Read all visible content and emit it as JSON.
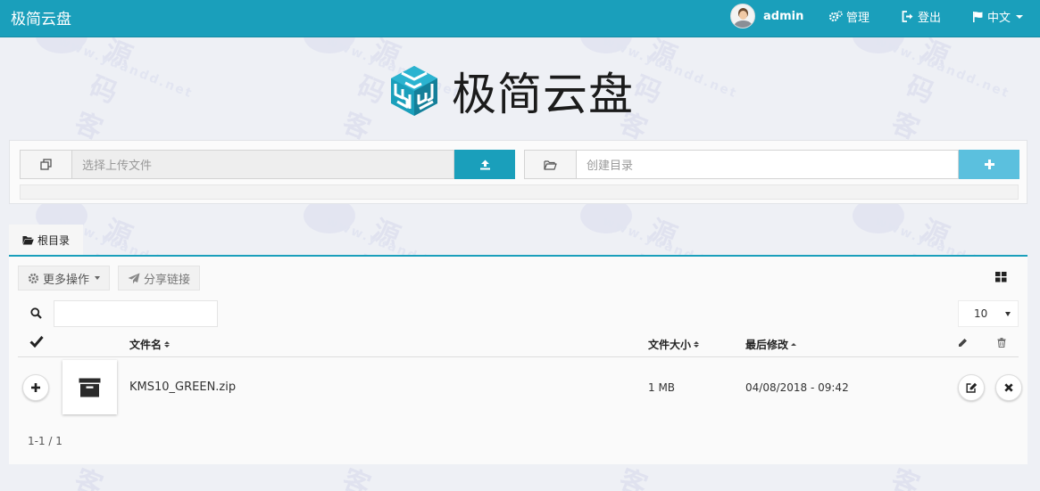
{
  "navbar": {
    "brand": "极简云盘",
    "user": "admin",
    "manage": "管理",
    "logout": "登出",
    "language": "中文"
  },
  "logo": {
    "title": "极简云盘"
  },
  "upload": {
    "placeholder": "选择上传文件"
  },
  "mkdir": {
    "placeholder": "创建目录"
  },
  "breadcrumb": {
    "root": "根目录"
  },
  "toolbar": {
    "more": "更多操作",
    "share": "分享链接"
  },
  "page_size": "10",
  "table": {
    "headers": {
      "name": "文件名",
      "size": "文件大小",
      "modified": "最后修改"
    },
    "rows": [
      {
        "name": "KMS10_GREEN.zip",
        "size": "1 MB",
        "modified": "04/08/2018 - 09:42"
      }
    ]
  },
  "pagination": "1-1 / 1",
  "watermark": {
    "text": "源码客",
    "url": "www.yuandd.net"
  },
  "colors": {
    "primary": "#1a9fbb",
    "info": "#5bc0de"
  }
}
